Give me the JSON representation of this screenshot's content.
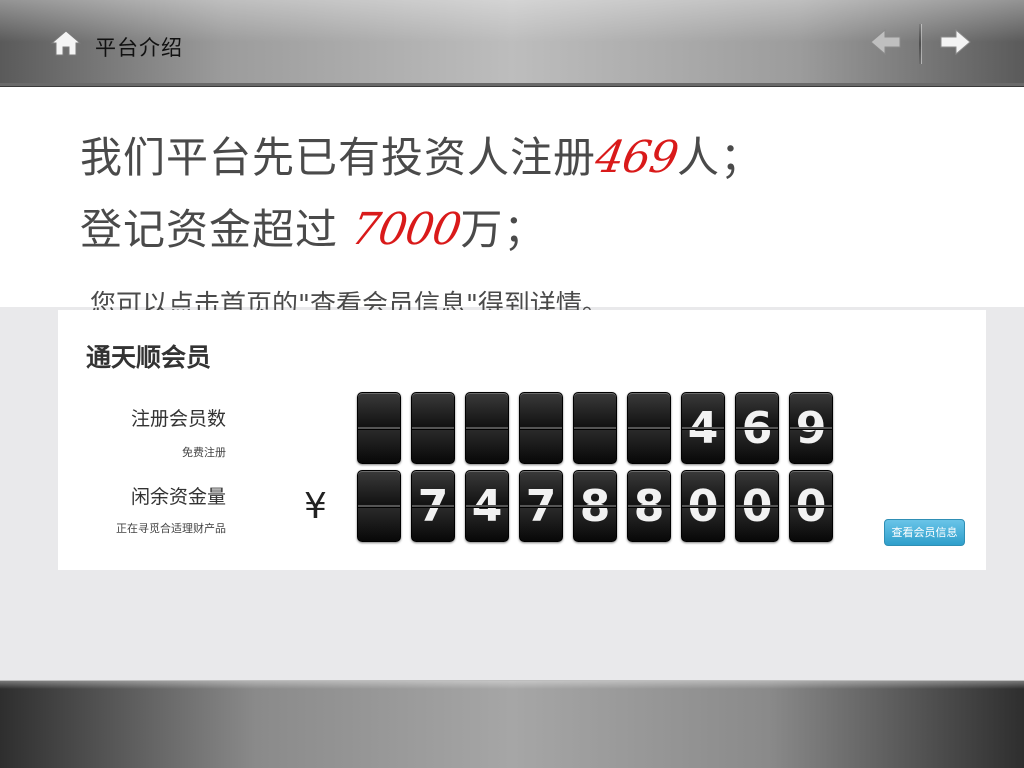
{
  "header": {
    "title": "平台介绍",
    "home_icon": "home-icon",
    "back_icon": "arrow-left-icon",
    "forward_icon": "arrow-right-icon"
  },
  "intro": {
    "line1_prefix": "我们平台先已有投资人注册",
    "line1_number": "469",
    "line1_suffix": "人；",
    "line2_prefix": "登记资金超过 ",
    "line2_number": "7000",
    "line2_suffix": "万；",
    "line3": "您可以点击首页的\"查看会员信息\"得到详情。"
  },
  "member_panel": {
    "title": "通天顺会员",
    "registered_label": "注册会员数",
    "registered_sub": "免费注册",
    "registered_digits": [
      "",
      "",
      "",
      "",
      "",
      "",
      "4",
      "6",
      "9"
    ],
    "funds_label": "闲余资金量",
    "funds_sub": "正在寻觅合适理财产品",
    "currency_symbol": "¥",
    "funds_digits": [
      "",
      "7",
      "4",
      "7",
      "8",
      "8",
      "0",
      "0",
      "0"
    ],
    "view_button": "查看会员信息"
  },
  "colors": {
    "highlight_red": "#d91a1a",
    "button_blue": "#2f9fcb"
  }
}
